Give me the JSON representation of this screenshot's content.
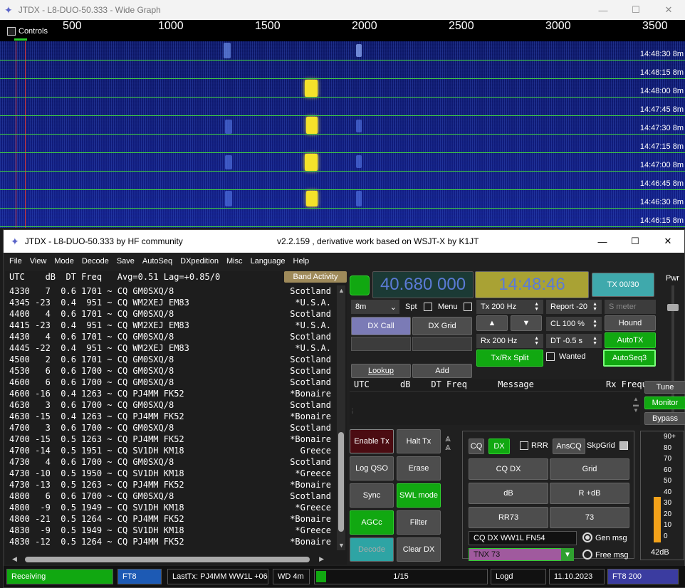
{
  "wide_graph": {
    "title": "JTDX - L8-DUO-50.333 - Wide Graph",
    "controls_label": "Controls",
    "freq_ticks": [
      "500",
      "1000",
      "1500",
      "2000",
      "2500",
      "3000",
      "3500"
    ],
    "times": [
      "14:48:30 8m",
      "14:48:15 8m",
      "14:48:00 8m",
      "14:47:45 8m",
      "14:47:30 8m",
      "14:47:15 8m",
      "14:47:00 8m",
      "14:46:45 8m",
      "14:46:30 8m",
      "14:46:15 8m"
    ]
  },
  "main": {
    "title": "JTDX - L8-DUO-50.333  by HF community",
    "version": "v2.2.159 , derivative work based on WSJT-X by K1JT",
    "menu": [
      "File",
      "View",
      "Mode",
      "Decode",
      "Save",
      "AutoSeq",
      "DXpedition",
      "Misc",
      "Language",
      "Help"
    ],
    "decode_header": "UTC    dB  DT Freq   Avg=0.51 Lag=+0.85/0",
    "band_activity": "Band Activity",
    "decodes": [
      {
        "text": "4330   7  0.6 1701 ~ CQ GM0SXQ/8",
        "country": "Scotland"
      },
      {
        "text": "4345 -23  0.4  951 ~ CQ WM2XEJ EM83",
        "country": "*U.S.A."
      },
      {
        "text": "4400   4  0.6 1701 ~ CQ GM0SXQ/8",
        "country": "Scotland"
      },
      {
        "text": "4415 -23  0.4  951 ~ CQ WM2XEJ EM83",
        "country": "*U.S.A."
      },
      {
        "text": "4430   4  0.6 1701 ~ CQ GM0SXQ/8",
        "country": "Scotland"
      },
      {
        "text": "4445 -22  0.4  951 ~ CQ WM2XEJ EM83",
        "country": "*U.S.A."
      },
      {
        "text": "4500   2  0.6 1701 ~ CQ GM0SXQ/8",
        "country": "Scotland"
      },
      {
        "text": "4530   6  0.6 1700 ~ CQ GM0SXQ/8",
        "country": "Scotland"
      },
      {
        "text": "4600   6  0.6 1700 ~ CQ GM0SXQ/8",
        "country": "Scotland"
      },
      {
        "text": "4600 -16  0.4 1263 ~ CQ PJ4MM FK52",
        "country": "*Bonaire"
      },
      {
        "text": "4630   3  0.6 1700 ~ CQ GM0SXQ/8",
        "country": "Scotland"
      },
      {
        "text": "4630 -15  0.4 1263 ~ CQ PJ4MM FK52",
        "country": "*Bonaire"
      },
      {
        "text": "4700   3  0.6 1700 ~ CQ GM0SXQ/8",
        "country": "Scotland"
      },
      {
        "text": "4700 -15  0.5 1263 ~ CQ PJ4MM FK52",
        "country": "*Bonaire"
      },
      {
        "text": "4700 -14  0.5 1951 ~ CQ SV1DH KM18",
        "country": "Greece"
      },
      {
        "text": "4730   4  0.6 1700 ~ CQ GM0SXQ/8",
        "country": "Scotland"
      },
      {
        "text": "4730 -10  0.5 1950 ~ CQ SV1DH KM18",
        "country": "*Greece"
      },
      {
        "text": "4730 -13  0.5 1263 ~ CQ PJ4MM FK52",
        "country": "*Bonaire"
      },
      {
        "text": "4800   6  0.6 1700 ~ CQ GM0SXQ/8",
        "country": "Scotland"
      },
      {
        "text": "4800  -9  0.5 1949 ~ CQ SV1DH KM18",
        "country": "*Greece"
      },
      {
        "text": "4800 -21  0.5 1264 ~ CQ PJ4MM FK52",
        "country": "*Bonaire"
      },
      {
        "text": "4830  -9  0.5 1949 ~ CQ SV1DH KM18",
        "country": "*Greece"
      },
      {
        "text": "4830 -12  0.5 1264 ~ CQ PJ4MM FK52",
        "country": "*Bonaire"
      }
    ],
    "freq_display": "40.680 000",
    "clock": "14:48:46",
    "tx_counter": "TX 00/30",
    "pwr_label": "Pwr",
    "band": "8m",
    "spt": "Spt",
    "menu_label": "Menu",
    "tx_freq": "Tx  200  Hz",
    "report": "Report -20",
    "smeter": "S meter",
    "dx_call": "DX Call",
    "dx_grid": "DX Grid",
    "cl": "CL  100 %",
    "hound": "Hound",
    "rx_freq": "Rx  200  Hz",
    "dt": "DT -0.5 s",
    "autotx": "AutoTX",
    "txrx_split": "Tx/Rx Split",
    "wanted": "Wanted",
    "autoseq3": "AutoSeq3",
    "lookup": "Lookup",
    "add": "Add",
    "rx_header": "UTC      dB    DT Freq      Message              Rx Frequency",
    "tune": "Tune",
    "monitor": "Monitor",
    "bypass": "Bypass",
    "enable_tx": "Enable Tx",
    "halt_tx": "Halt Tx",
    "log_qso": "Log QSO",
    "erase": "Erase",
    "sync": "Sync",
    "swl_mode": "SWL mode",
    "agcc": "AGCc",
    "filter": "Filter",
    "decode_btn": "Decode",
    "clear_dx": "Clear DX",
    "cq": "CQ",
    "dx": "DX",
    "rrr": "RRR",
    "anscq": "AnsCQ",
    "skpgrid": "SkpGrid",
    "cq_dx": "CQ DX",
    "grid": "Grid",
    "db": "dB",
    "r_db": "R +dB",
    "rr73": "RR73",
    "n73": "73",
    "gen_msg_value": "CQ DX WW1L FN54",
    "gen_msg": "Gen msg",
    "free_msg_value": "TNX 73",
    "free_msg": "Free msg",
    "meter_labels": [
      "90+",
      "80",
      "70",
      "60",
      "50",
      "40",
      "30",
      "20",
      "10",
      "0"
    ],
    "meter_db": "42dB",
    "meter_level": 0.42
  },
  "status": {
    "receiving": "Receiving",
    "mode": "FT8",
    "last_tx": "LastTx: PJ4MM WW1L +06",
    "wd": "WD 4m",
    "progress": "1/15",
    "logd": "Logd",
    "date": "11.10.2023",
    "mode_freq": "FT8  200"
  }
}
